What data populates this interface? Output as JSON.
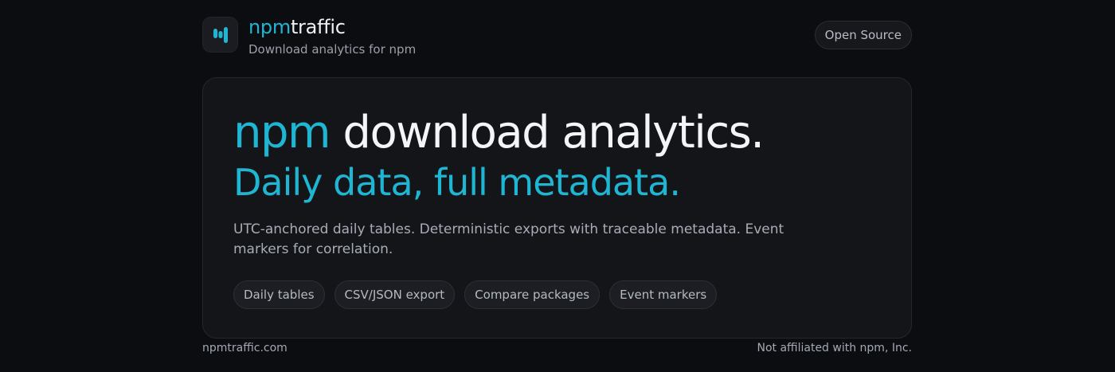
{
  "header": {
    "logo_icon": "bar-chart-icon",
    "brand_part1": "npm",
    "brand_part2": "traffic",
    "tagline": "Download analytics for npm",
    "open_source_label": "Open Source"
  },
  "hero": {
    "title_accent": "npm",
    "title_rest": "download analytics.",
    "subtitle": "Daily data, full metadata.",
    "description": "UTC-anchored daily tables. Deterministic exports with traceable metadata. Event markers for correlation.",
    "chips": [
      "Daily tables",
      "CSV/JSON export",
      "Compare packages",
      "Event markers"
    ]
  },
  "footer": {
    "domain": "npmtraffic.com",
    "disclaimer": "Not affiliated with npm, Inc."
  },
  "colors": {
    "accent": "#1fb6d3",
    "background": "#0c0d10",
    "card": "#141519"
  }
}
